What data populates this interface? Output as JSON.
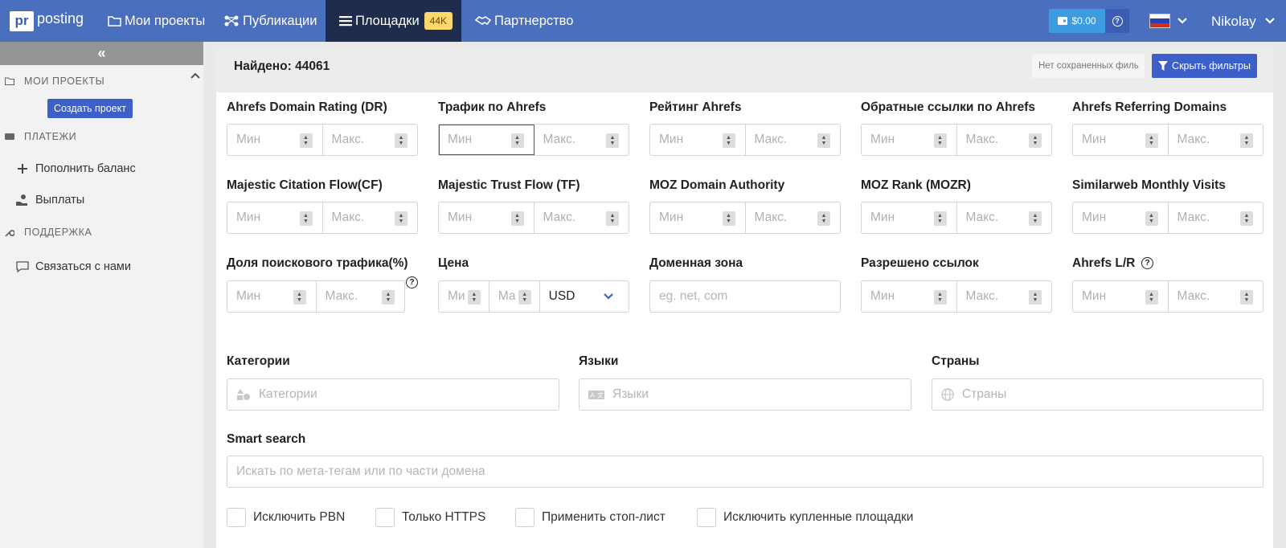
{
  "header": {
    "logo_mark": "pr",
    "logo_text": "posting",
    "nav": [
      {
        "label": "Мои проекты"
      },
      {
        "label": "Публикации"
      },
      {
        "label": "Площадки",
        "badge": "44K"
      },
      {
        "label": "Партнерство"
      }
    ],
    "balance": "$0.00",
    "help": "?",
    "user": "Nikolay"
  },
  "sidebar": {
    "collapse": "«",
    "projects_heading": "МОИ ПРОЕКТЫ",
    "create_project": "Создать проект",
    "payments_heading": "ПЛАТЕЖИ",
    "topup": "Пополнить баланс",
    "payouts": "Выплаты",
    "support_heading": "ПОДДЕРЖКА",
    "contact": "Связаться с нами"
  },
  "results": {
    "found": "Найдено: 44061",
    "saved_filters": "Нет сохраненных филь",
    "hide_filters": "Скрыть фильтры"
  },
  "filters": {
    "min_placeholder": "Мин",
    "max_placeholder": "Макс.",
    "price_min": "Ми",
    "price_max": "Ма",
    "fields": [
      "Ahrefs Domain Rating (DR)",
      "Трафик по Ahrefs",
      "Рейтинг Ahrefs",
      "Обратные ссылки по Ahrefs",
      "Ahrefs Referring Domains",
      "Majestic Citation Flow(CF)",
      "Majestic Trust Flow (TF)",
      "MOZ Domain Authority",
      "MOZ Rank (MOZR)",
      "Similarweb Monthly Visits",
      "Доля поискового трафика(%)",
      "Цена",
      "Доменная зона",
      "Разрешено ссылок",
      "Ahrefs L/R"
    ],
    "currency": "USD",
    "domain_zone_placeholder": "eg. net, com",
    "categories_label": "Категории",
    "categories_placeholder": "Категории",
    "languages_label": "Языки",
    "languages_placeholder": "Языки",
    "countries_label": "Страны",
    "countries_placeholder": "Страны",
    "smart_label": "Smart search",
    "smart_placeholder": "Искать по мета-тегам или по части домена",
    "checkboxes": [
      "Исключить PBN",
      "Только HTTPS",
      "Применить стоп-лист",
      "Исключить купленные площадки"
    ]
  },
  "colors": {
    "topbar": "#4a6fbf",
    "primary_button": "#3c5fc9",
    "badge": "#ffd86b",
    "balance": "#3d9be0"
  }
}
